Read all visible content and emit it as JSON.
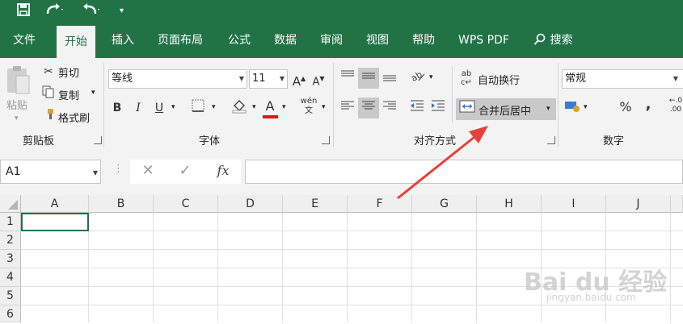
{
  "quick_access": {
    "save_icon": "save-icon",
    "redo_icon": "redo-icon",
    "undo_icon": "undo-icon"
  },
  "menu": {
    "tabs": [
      "文件",
      "开始",
      "插入",
      "页面布局",
      "公式",
      "数据",
      "审阅",
      "视图",
      "帮助",
      "WPS PDF"
    ],
    "search_label": "搜索"
  },
  "clipboard": {
    "paste": "粘贴",
    "cut": "剪切",
    "copy": "复制",
    "format_painter": "格式刷",
    "group": "剪贴板"
  },
  "font": {
    "name": "等线",
    "size": "11",
    "bold": "B",
    "italic": "I",
    "underline": "U",
    "font_color": "A",
    "group": "字体"
  },
  "alignment": {
    "wrap_text": "自动换行",
    "merge_center": "合并后居中",
    "group": "对齐方式"
  },
  "number": {
    "format": "常规",
    "percent": "%",
    "comma": ",",
    "group": "数字"
  },
  "formula_bar": {
    "name_box": "A1",
    "fx": "fx"
  },
  "grid": {
    "columns": [
      "A",
      "B",
      "C",
      "D",
      "E",
      "F",
      "G",
      "H",
      "I",
      "J"
    ],
    "rows": [
      "1",
      "2",
      "3",
      "4",
      "5",
      "6"
    ]
  },
  "colors": {
    "brand": "#217346",
    "arrow": "#e8403a",
    "font_color_bar": "#e81123"
  },
  "watermark": {
    "main": "Bai du 经验",
    "sub": "jingyan.baidu.com"
  }
}
